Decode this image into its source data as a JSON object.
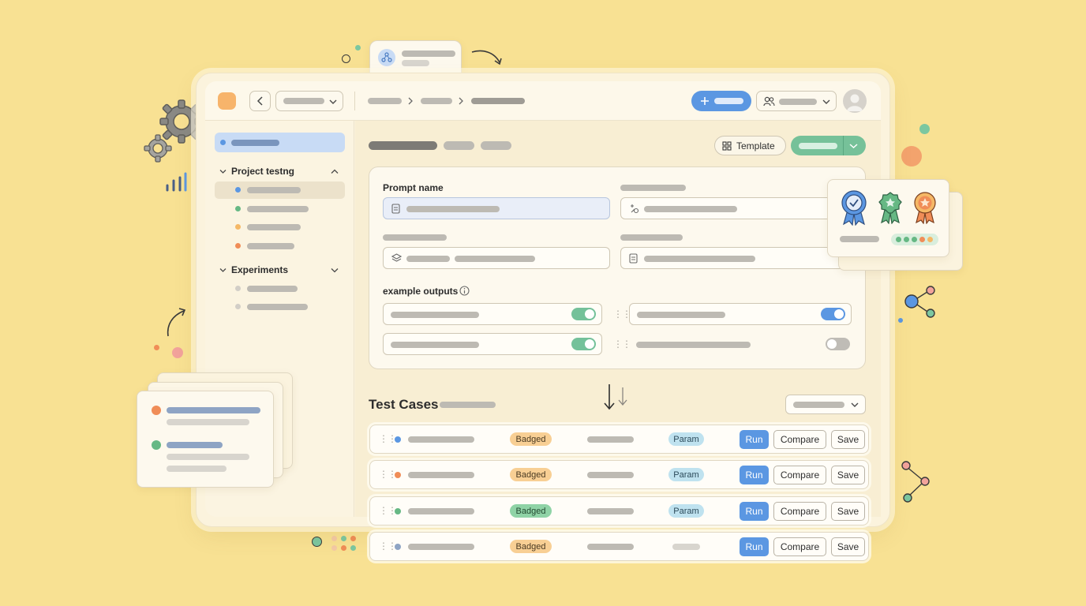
{
  "sidebar": {
    "sections": [
      {
        "label": "Project testng",
        "expanded": true
      },
      {
        "label": "Experiments",
        "expanded": false
      }
    ]
  },
  "toolbar": {
    "template_label": "Template"
  },
  "form": {
    "prompt_name_label": "Prompt name",
    "example_outputs_label": "example outputs",
    "toggles": [
      true,
      true,
      true,
      false
    ]
  },
  "test_cases": {
    "title": "Test Cases",
    "rows": [
      {
        "status_color": "#5b97e2",
        "badge": "Badged",
        "badge_color": "#f8cf94",
        "param": "Param",
        "run": "Run",
        "compare": "Compare",
        "save": "Save"
      },
      {
        "status_color": "#f08d57",
        "badge": "Badged",
        "badge_color": "#f8cf94",
        "param": "Param",
        "run": "Run",
        "compare": "Compare",
        "save": "Save"
      },
      {
        "status_color": "#66b884",
        "badge": "Badged",
        "badge_color": "#8fd3a6",
        "param": "Param",
        "run": "Run",
        "compare": "Compare",
        "save": "Save"
      },
      {
        "status_color": "#8ea4c4",
        "badge": "Badged",
        "badge_color": "#f8cf94",
        "param": "",
        "run": "Run",
        "compare": "Compare",
        "save": "Save"
      }
    ]
  },
  "colors": {
    "background": "#f8e193",
    "accent_blue": "#5b97e2",
    "accent_green": "#76c199",
    "accent_orange": "#f08d57"
  },
  "icons": [
    "logo-icon",
    "back-icon",
    "chevron-down-icon",
    "plus-icon",
    "users-icon",
    "avatar",
    "template-grid-icon",
    "document-icon",
    "sparkle-icon",
    "layers-icon",
    "info-icon",
    "drag-handle-icon",
    "gear-icon",
    "bar-chart-icon",
    "award-ribbon-icon",
    "share-network-icon"
  ]
}
